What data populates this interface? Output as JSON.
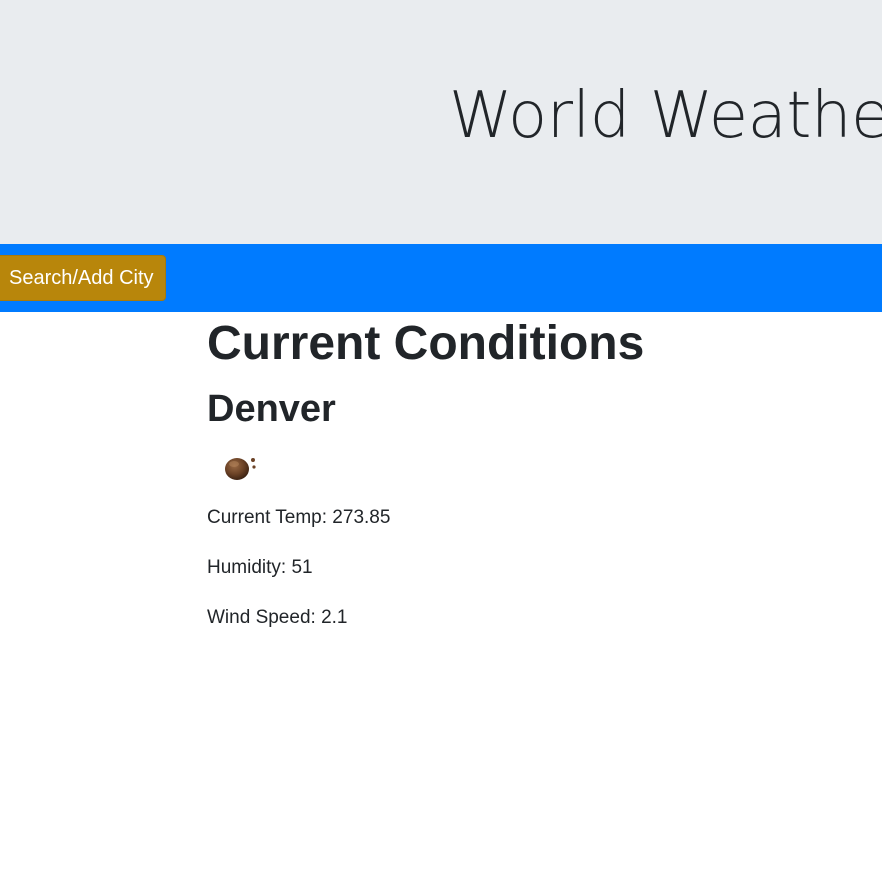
{
  "header": {
    "title": "World Weather"
  },
  "navbar": {
    "search_button_label": "Search/Add City",
    "accent_color": "#007bff",
    "button_color": "#b8860b"
  },
  "main": {
    "section_title": "Current Conditions",
    "city": "Denver",
    "weather_icon": "weather-condition-icon",
    "temp_text": "Current Temp: 273.85",
    "humidity_text": "Humidity: 51",
    "wind_text": "Wind Speed: 2.1"
  }
}
